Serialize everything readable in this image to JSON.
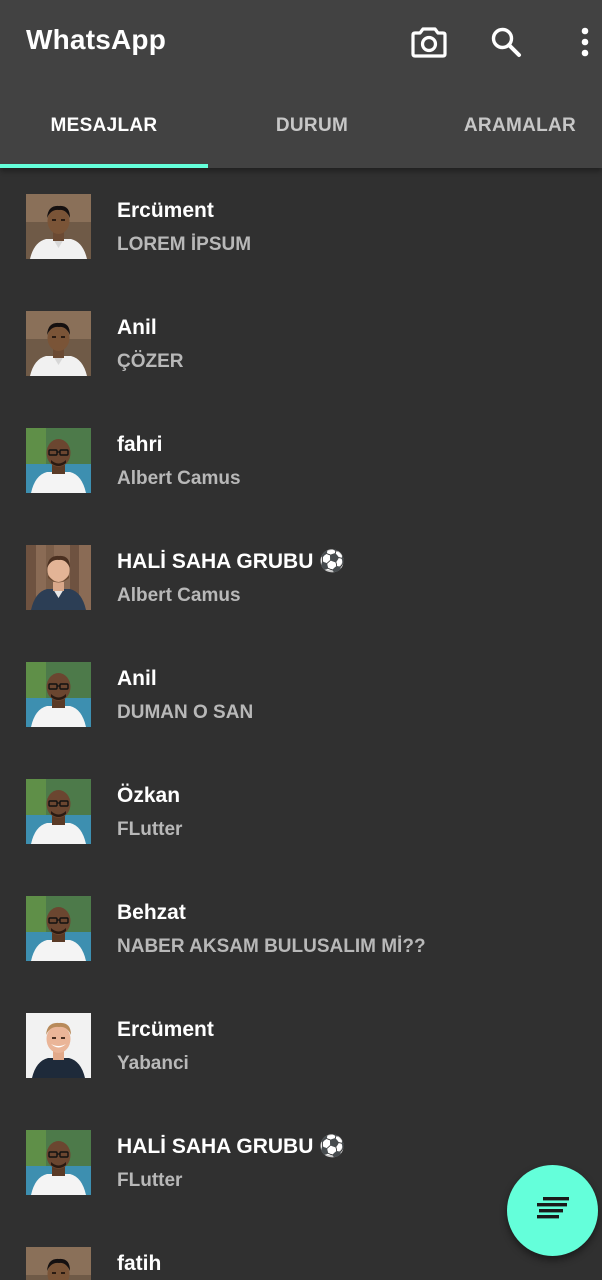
{
  "appbar": {
    "title": "WhatsApp",
    "actions": [
      "camera-icon",
      "search-icon",
      "more-vert-icon"
    ]
  },
  "tabs": [
    {
      "label": "MESAJLAR",
      "selected": true
    },
    {
      "label": "DURUM",
      "selected": false
    },
    {
      "label": "ARAMALAR",
      "selected": false
    }
  ],
  "colors": {
    "background": "#303030",
    "appbar": "#424242",
    "accent": "#64ffda",
    "name_text": "#ffffff",
    "message_text": "#b8b8b8"
  },
  "chats": [
    {
      "name": "Ercüment",
      "message": "LOREM İPSUM",
      "avatar": "avatar-young-man"
    },
    {
      "name": "Anil",
      "message": "ÇÖZER",
      "avatar": "avatar-young-man"
    },
    {
      "name": "fahri",
      "message": "Albert Camus",
      "avatar": "avatar-man-glasses"
    },
    {
      "name": "HALİ SAHA GRUBU ⚽",
      "message": "Albert Camus",
      "avatar": "avatar-bearded-man"
    },
    {
      "name": "Anil",
      "message": "DUMAN O SAN",
      "avatar": "avatar-man-glasses"
    },
    {
      "name": "Özkan",
      "message": "FLutter",
      "avatar": "avatar-man-glasses"
    },
    {
      "name": "Behzat",
      "message": "NABER AKSAM BULUSALIM Mİ??",
      "avatar": "avatar-man-glasses"
    },
    {
      "name": "Ercüment",
      "message": "Yabanci",
      "avatar": "avatar-smiling-man"
    },
    {
      "name": "HALİ SAHA GRUBU ⚽",
      "message": "FLutter",
      "avatar": "avatar-man-glasses"
    },
    {
      "name": "fatih",
      "message": "",
      "avatar": "avatar-young-man"
    }
  ],
  "fab": {
    "icon": "sort-icon"
  }
}
